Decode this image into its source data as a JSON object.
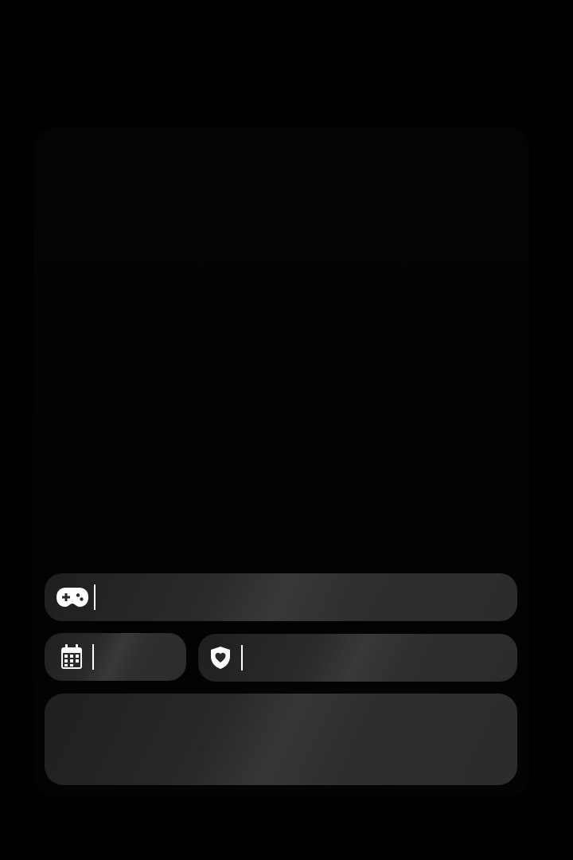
{
  "form": {
    "game_field": {
      "icon": "gamepad-icon",
      "value": ""
    },
    "date_field": {
      "icon": "calendar-icon",
      "value": ""
    },
    "rating_field": {
      "icon": "shield-heart-icon",
      "value": ""
    },
    "notes_field": {
      "value": ""
    }
  },
  "colors": {
    "background": "#000000",
    "field": "#2c2c2c",
    "icon": "#ffffff"
  }
}
